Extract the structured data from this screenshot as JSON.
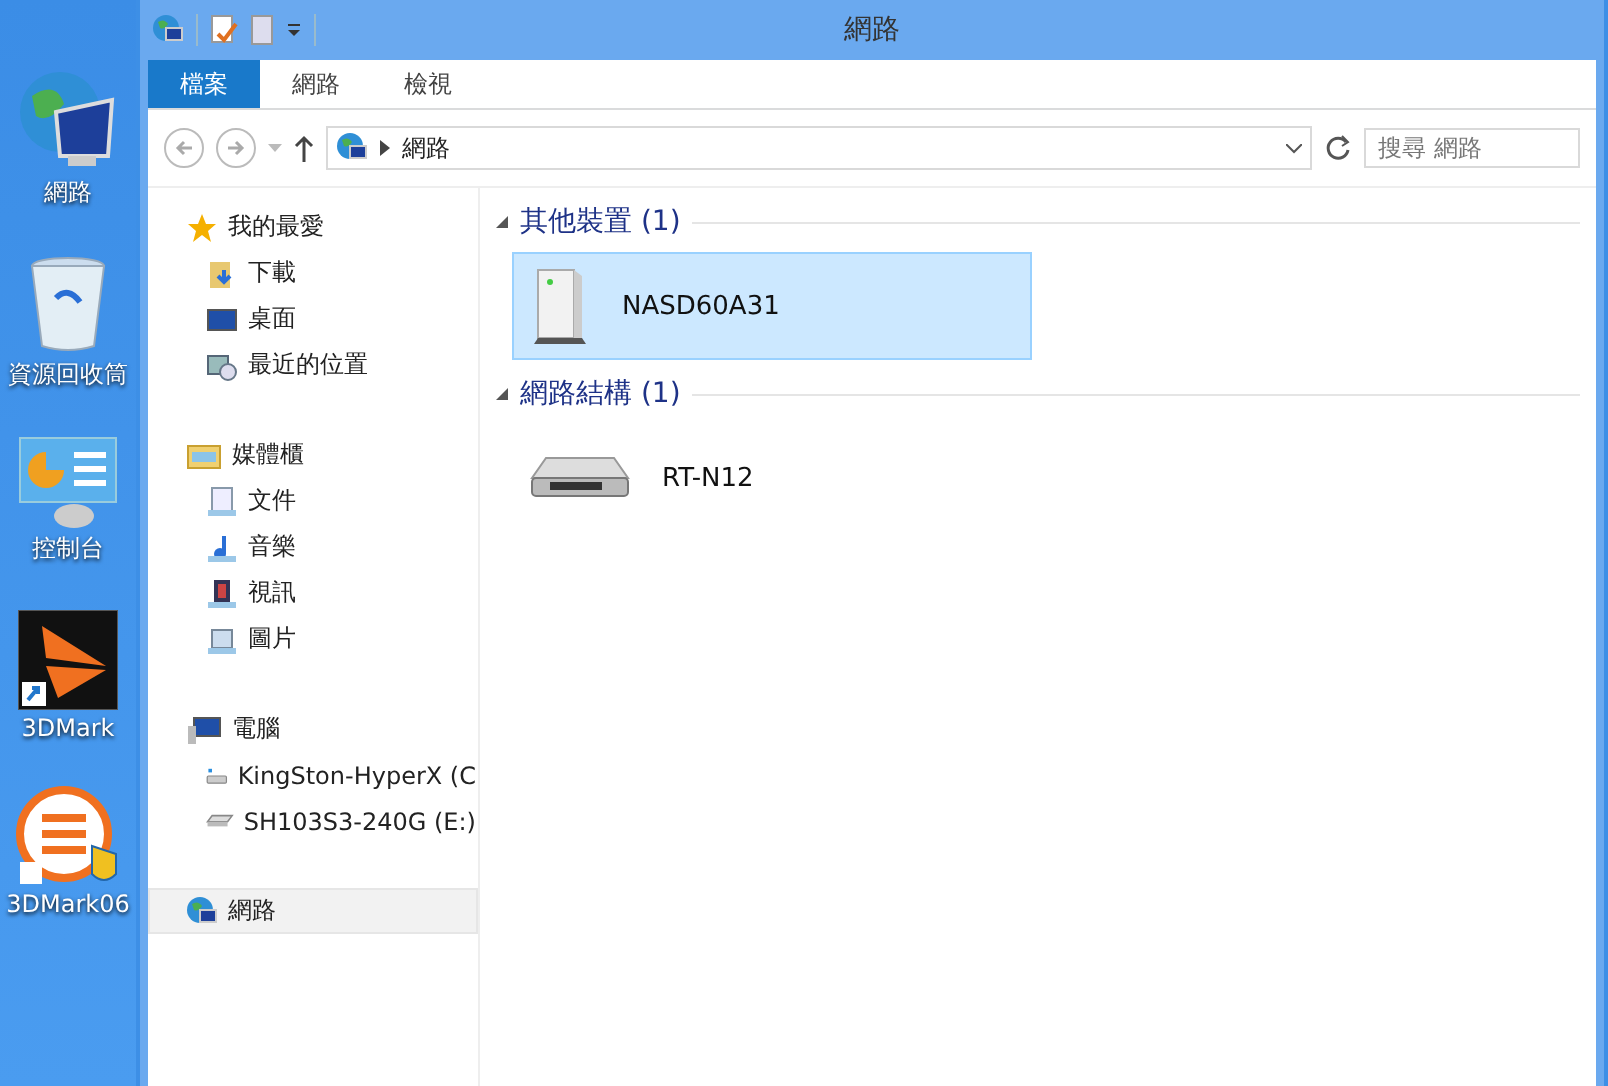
{
  "desktop": {
    "icons": [
      {
        "kind": "network",
        "label": "網路"
      },
      {
        "kind": "recycle",
        "label": "資源回收筒"
      },
      {
        "kind": "control",
        "label": "控制台"
      },
      {
        "kind": "mark",
        "label": "3DMark"
      },
      {
        "kind": "mark06",
        "label": "3DMark06"
      }
    ]
  },
  "window": {
    "title": "網路"
  },
  "tabs": [
    {
      "label": "檔案",
      "selected": true
    },
    {
      "label": "網路",
      "selected": false
    },
    {
      "label": "檢視",
      "selected": false
    }
  ],
  "address": {
    "path": "網路"
  },
  "search": {
    "placeholder": "搜尋 網路"
  },
  "sidebar": {
    "groups": [
      {
        "kind": "star",
        "label": "我的最愛",
        "selected": false,
        "children": [
          {
            "kind": "download",
            "label": "下載",
            "selected": false
          },
          {
            "kind": "desktop",
            "label": "桌面",
            "selected": false
          },
          {
            "kind": "recent",
            "label": "最近的位置",
            "selected": false
          }
        ]
      },
      {
        "kind": "library",
        "label": "媒體櫃",
        "selected": false,
        "children": [
          {
            "kind": "doc",
            "label": "文件",
            "selected": false
          },
          {
            "kind": "music",
            "label": "音樂",
            "selected": false
          },
          {
            "kind": "video",
            "label": "視訊",
            "selected": false
          },
          {
            "kind": "image",
            "label": "圖片",
            "selected": false
          }
        ]
      },
      {
        "kind": "pc",
        "label": "電腦",
        "selected": false,
        "children": [
          {
            "kind": "drive",
            "label": "KingSton-HyperX (C",
            "selected": false
          },
          {
            "kind": "drive2",
            "label": "SH103S3-240G (E:)",
            "selected": false
          }
        ]
      },
      {
        "kind": "network",
        "label": "網路",
        "selected": true
      }
    ]
  },
  "sections": [
    {
      "title": "其他裝置 (1)",
      "items": [
        {
          "kind": "nas",
          "label": "NASD60A31",
          "selected": true
        }
      ]
    },
    {
      "title": "網路結構 (1)",
      "items": [
        {
          "kind": "router",
          "label": "RT-N12",
          "selected": false
        }
      ]
    }
  ]
}
